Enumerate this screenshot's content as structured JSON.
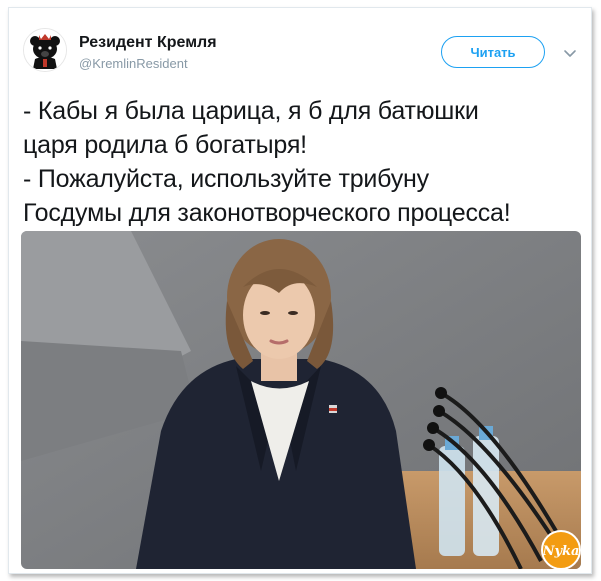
{
  "author": {
    "name": "Резидент Кремля",
    "handle": "@KremlinResident",
    "avatar_icon": "bear-emblem-icon"
  },
  "follow_button": {
    "label": "Читать"
  },
  "menu_icon": "chevron-down-icon",
  "tweet": {
    "text": "- Кабы я была царица, я б для батюшки\nцаря родила б богатыря!\n- Пожалуйста, используйте трибуну\nГосдумы для законотворческого процесса!"
  },
  "photo": {
    "subject": "woman-at-podium-photo"
  },
  "watermark": {
    "text": "Nyka",
    "color": "#f39c12"
  },
  "colors": {
    "accent": "#1da1f2",
    "text": "#14171a",
    "muted": "#8899a6"
  }
}
